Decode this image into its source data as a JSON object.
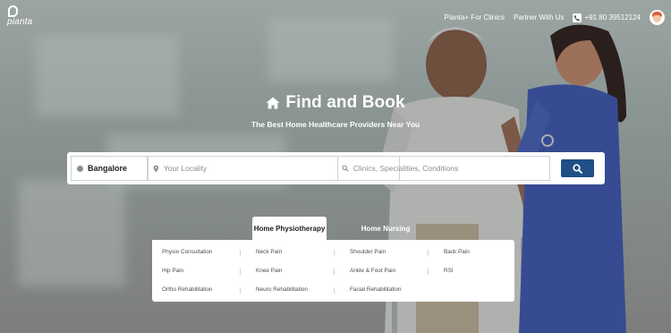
{
  "brand": {
    "name": "pianta"
  },
  "nav": {
    "clinics": "Pianta+ For Clinics",
    "partner": "Partner With Us",
    "phone": "+91 80 39512124"
  },
  "hero": {
    "title": "Find and Book",
    "subtitle": "The Best Home Healthcare Providers Near You"
  },
  "search": {
    "city": "Bangalore",
    "locality_placeholder": "Your Locality",
    "query_placeholder": "Clinics, Specialities, Conditions",
    "button_icon": "search-icon",
    "button_color": "#1e4f85"
  },
  "tabs": [
    {
      "label": "Home Physiotherapy",
      "active": true
    },
    {
      "label": "Home Nursing",
      "active": false
    }
  ],
  "services": [
    [
      "Physio Consultation",
      "Neck Pain",
      "Shoulder Pain",
      "Back Pain"
    ],
    [
      "Hip Pain",
      "Knee Pain",
      "Ankle & Foot Pain",
      "RSI"
    ],
    [
      "Ortho Rehabilitation",
      "Neuro Rehabilitation",
      "Facial Rehabilitation"
    ]
  ]
}
